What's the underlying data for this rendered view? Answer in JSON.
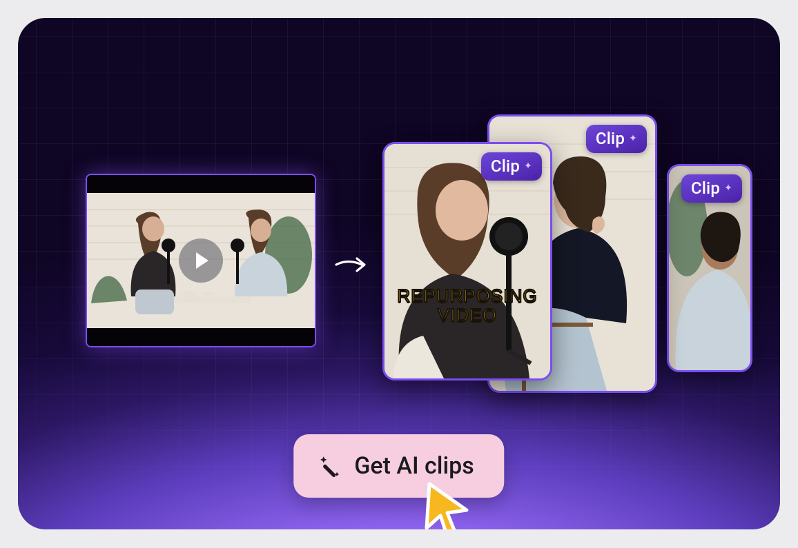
{
  "cta": {
    "label": "Get AI clips"
  },
  "clips": [
    {
      "badge": "Clip",
      "caption_line1": "REPURPOSING",
      "caption_line2": "VIDEO"
    },
    {
      "badge": "Clip"
    },
    {
      "badge": "Clip"
    }
  ],
  "icons": {
    "play": "play-icon",
    "arrow": "arrow-right-icon",
    "wand": "magic-wand-sparkle-icon",
    "cursor": "yellow-cursor-icon",
    "sparkle": "sparkle-icon"
  }
}
